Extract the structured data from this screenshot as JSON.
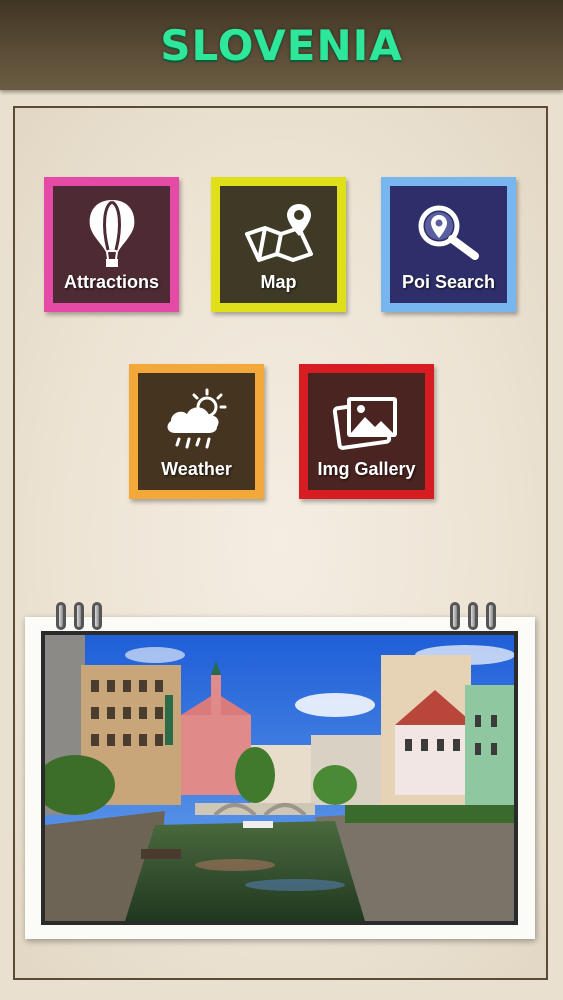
{
  "app": {
    "title": "SLOVENIA"
  },
  "tiles": [
    {
      "label": "Attractions",
      "icon": "hot-air-balloon-icon",
      "color": "#e54aa6"
    },
    {
      "label": "Map",
      "icon": "map-pin-icon",
      "color": "#dfe01a"
    },
    {
      "label": "Poi Search",
      "icon": "magnifier-pin-icon",
      "color": "#78b6f0"
    },
    {
      "label": "Weather",
      "icon": "weather-cloud-sun-icon",
      "color": "#f3a93a"
    },
    {
      "label": "Img Gallery",
      "icon": "photo-gallery-icon",
      "color": "#d81d22"
    }
  ],
  "colors": {
    "header_text": "#2ee79a",
    "header_bg": "#4a3e2b",
    "background": "#e9e0d0"
  }
}
